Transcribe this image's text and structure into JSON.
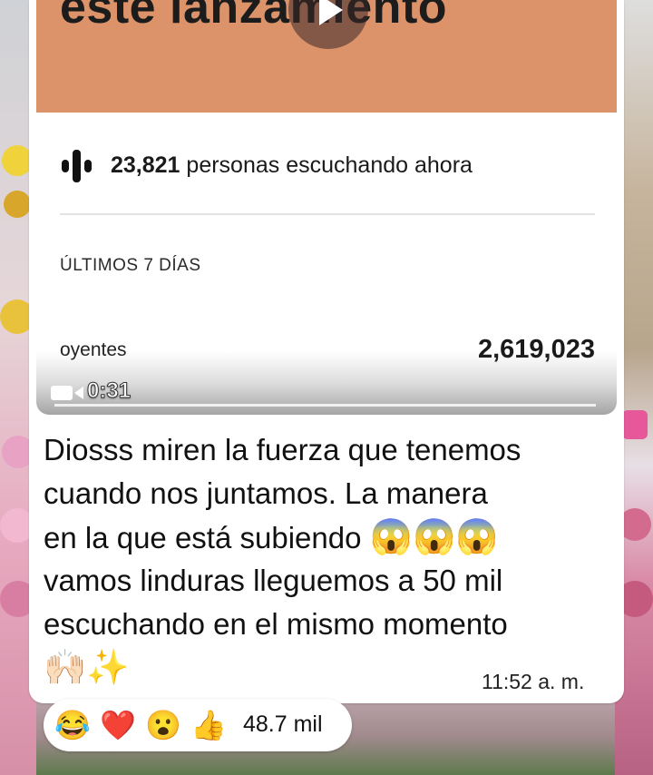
{
  "video": {
    "banner_text": "este lanzamiento",
    "listeners_count": "23,821",
    "listeners_text": "personas escuchando ahora",
    "section_title": "ÚLTIMOS 7 DÍAS",
    "metric_label": "oyentes",
    "metric_value": "2,619,023",
    "duration": "0:31",
    "icons": {
      "play": "play-icon",
      "camera": "video-camera-icon",
      "bars": "live-listeners-icon"
    }
  },
  "message": {
    "lines": [
      "Diosss miren la fuerza que tenemos",
      "cuando nos juntamos. La manera",
      "en la que está subiendo",
      "vamos linduras lleguemos a 50 mil",
      "escuchando en el mismo momento"
    ],
    "emojis_line3": [
      "😱",
      "😱",
      "😱"
    ],
    "emojis_line6": [
      "🙌🏻",
      "✨"
    ],
    "timestamp": "11:52 a. m."
  },
  "reactions": {
    "emojis": [
      "😂",
      "❤️",
      "😮",
      "👍"
    ],
    "count": "48.7 mil"
  },
  "colors": {
    "banner": "#dc936a",
    "bubble": "#ffffff",
    "text": "#111111"
  }
}
